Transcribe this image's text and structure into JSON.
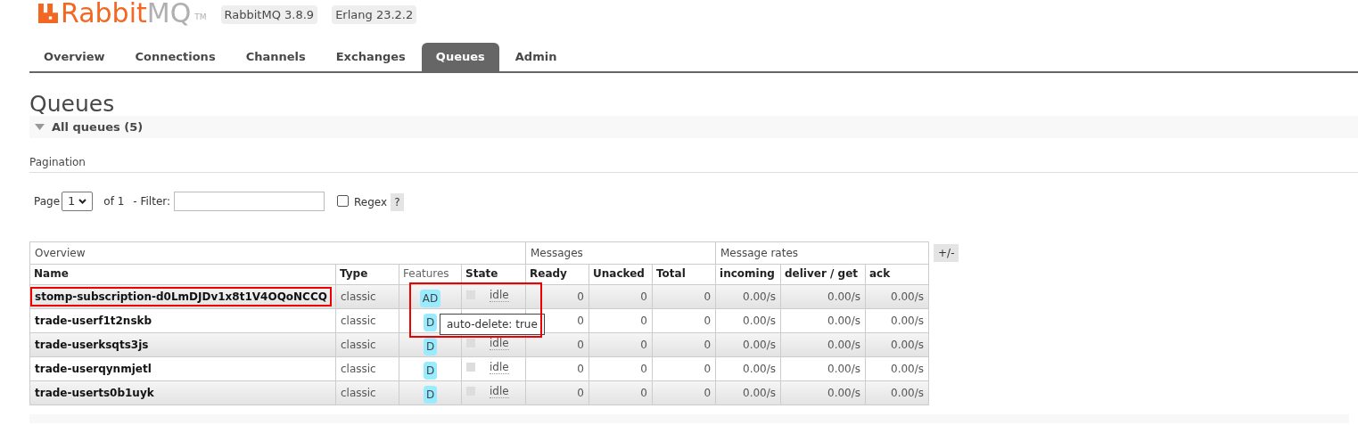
{
  "logo": {
    "brand_a": "Rabbit",
    "brand_b": "MQ",
    "trademark": "TM"
  },
  "versions": [
    "RabbitMQ 3.8.9",
    "Erlang 23.2.2"
  ],
  "tabs": [
    {
      "label": "Overview",
      "selected": false
    },
    {
      "label": "Connections",
      "selected": false
    },
    {
      "label": "Channels",
      "selected": false
    },
    {
      "label": "Exchanges",
      "selected": false
    },
    {
      "label": "Queues",
      "selected": true
    },
    {
      "label": "Admin",
      "selected": false
    }
  ],
  "heading": "Queues",
  "section": {
    "title": "All queues (5)",
    "expanded": true
  },
  "pagination": {
    "title": "Pagination",
    "page_label": "Page",
    "page": "1",
    "of": "of 1",
    "filter_label": "- Filter:",
    "regex_label": "Regex",
    "regex_checked": false,
    "help": "?"
  },
  "table": {
    "groups": [
      "Overview",
      "Messages",
      "Message rates"
    ],
    "columns": [
      "Name",
      "Type",
      "Features",
      "State",
      "Ready",
      "Unacked",
      "Total",
      "incoming",
      "deliver / get",
      "ack"
    ],
    "toggle": "+/-",
    "rows": [
      {
        "name": "stomp-subscription-d0LmDJDv1x8t1V4OQoNCCQ",
        "type": "classic",
        "features": "AD",
        "state": "idle",
        "ready": "0",
        "unacked": "0",
        "total": "0",
        "incoming": "0.00/s",
        "deliver": "0.00/s",
        "ack": "0.00/s",
        "highlighted": true
      },
      {
        "name": "trade-userf1t2nskb",
        "type": "classic",
        "features": "D",
        "state": null,
        "ready": "0",
        "unacked": "0",
        "total": "0",
        "incoming": "0.00/s",
        "deliver": "0.00/s",
        "ack": "0.00/s",
        "highlighted": false
      },
      {
        "name": "trade-userksqts3js",
        "type": "classic",
        "features": "D",
        "state": "idle",
        "ready": "0",
        "unacked": "0",
        "total": "0",
        "incoming": "0.00/s",
        "deliver": "0.00/s",
        "ack": "0.00/s",
        "highlighted": false
      },
      {
        "name": "trade-userqynmjetl",
        "type": "classic",
        "features": "D",
        "state": "idle",
        "ready": "0",
        "unacked": "0",
        "total": "0",
        "incoming": "0.00/s",
        "deliver": "0.00/s",
        "ack": "0.00/s",
        "highlighted": false
      },
      {
        "name": "trade-userts0b1uyk",
        "type": "classic",
        "features": "D",
        "state": "idle",
        "ready": "0",
        "unacked": "0",
        "total": "0",
        "incoming": "0.00/s",
        "deliver": "0.00/s",
        "ack": "0.00/s",
        "highlighted": false
      }
    ]
  },
  "tooltip": {
    "text": "auto-delete: true",
    "highlighted": true
  }
}
